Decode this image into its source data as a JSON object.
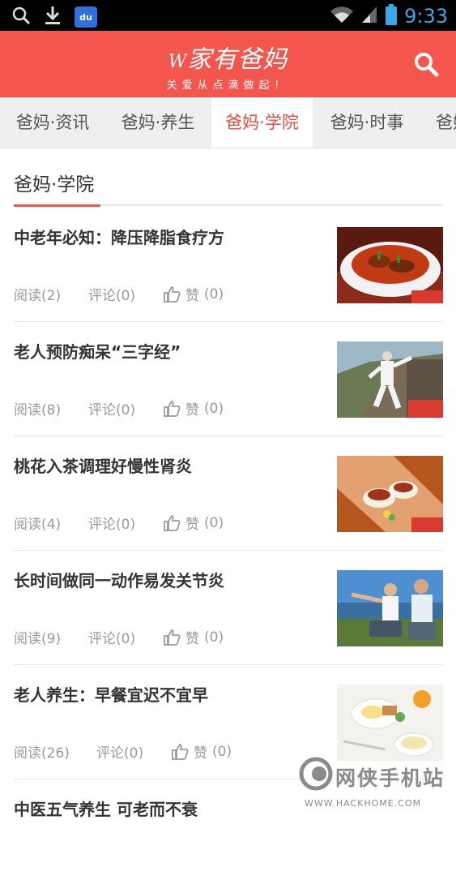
{
  "status_bar": {
    "time": "9:33",
    "icons": [
      "search-icon",
      "download-icon",
      "baidu-app-icon",
      "wifi-icon",
      "signal-icon",
      "battery-icon"
    ],
    "baidu_label": "du"
  },
  "header": {
    "logo_prefix": "W",
    "logo_title": "家有爸妈",
    "logo_slogan": "关爱从点滴做起！",
    "bg_color": "#f4554c"
  },
  "tabs": [
    {
      "label": "爸妈·资讯",
      "active": false
    },
    {
      "label": "爸妈·养生",
      "active": false
    },
    {
      "label": "爸妈·学院",
      "active": true
    },
    {
      "label": "爸妈·时事",
      "active": false
    },
    {
      "label": "爸妈",
      "active": false
    }
  ],
  "section": {
    "title": "爸妈·学院"
  },
  "articles": [
    {
      "title": "中老年必知：降压降脂食疗方",
      "read": "阅读(2)",
      "comment": "评论(0)",
      "like_label": "赞",
      "like_count": "(0)",
      "image": "food-dish-thumbnail"
    },
    {
      "title": "老人预防痴呆“三字经”",
      "read": "阅读(8)",
      "comment": "评论(0)",
      "like_label": "赞",
      "like_count": "(0)",
      "image": "great-wall-taichi-thumbnail"
    },
    {
      "title": "桃花入茶调理好慢性肾炎",
      "read": "阅读(4)",
      "comment": "评论(0)",
      "like_label": "赞",
      "like_count": "(0)",
      "image": "tea-cups-thumbnail"
    },
    {
      "title": "长时间做同一动作易发关节炎",
      "read": "阅读(9)",
      "comment": "评论(0)",
      "like_label": "赞",
      "like_count": "(0)",
      "image": "elderly-couple-thumbnail"
    },
    {
      "title": "老人养生：早餐宜迟不宜早",
      "read": "阅读(26)",
      "comment": "评论(0)",
      "like_label": "赞",
      "like_count": "(0)",
      "image": "breakfast-thumbnail"
    },
    {
      "title": "中医五气养生 可老而不衰",
      "read": "",
      "comment": "",
      "like_label": "",
      "like_count": "",
      "image": ""
    }
  ],
  "watermark": {
    "text": "网侠手机站",
    "sub": "WWW.HACKHOME.COM"
  }
}
